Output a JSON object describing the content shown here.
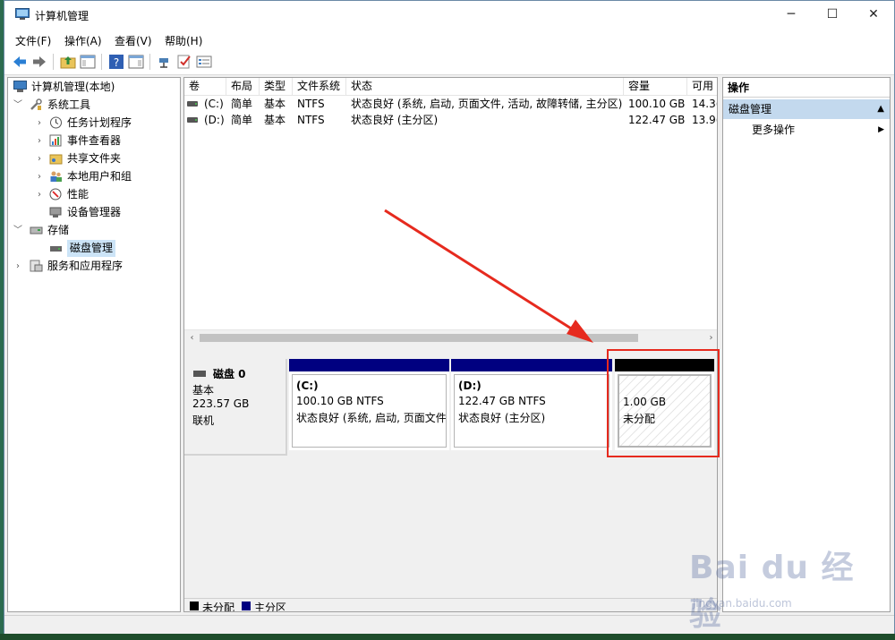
{
  "window": {
    "title": "计算机管理",
    "min": "─",
    "max": "☐",
    "close": "✕"
  },
  "menu": [
    "文件(F)",
    "操作(A)",
    "查看(V)",
    "帮助(H)"
  ],
  "tree": {
    "root": "计算机管理(本地)",
    "system_tools": "系统工具",
    "task_scheduler": "任务计划程序",
    "event_viewer": "事件查看器",
    "shared_folders": "共享文件夹",
    "local_users": "本地用户和组",
    "performance": "性能",
    "device_manager": "设备管理器",
    "storage": "存储",
    "disk_management": "磁盘管理",
    "services": "服务和应用程序"
  },
  "volume_list": {
    "headers": [
      "卷",
      "布局",
      "类型",
      "文件系统",
      "状态",
      "容量",
      "可用"
    ],
    "rows": [
      [
        "(C:)",
        "简单",
        "基本",
        "NTFS",
        "状态良好 (系统, 启动, 页面文件, 活动, 故障转储, 主分区)",
        "100.10 GB",
        "14.3("
      ],
      [
        "(D:)",
        "简单",
        "基本",
        "NTFS",
        "状态良好 (主分区)",
        "122.47 GB",
        "13.9("
      ]
    ]
  },
  "disk": {
    "name": "磁盘 0",
    "type": "基本",
    "size": "223.57 GB",
    "status": "联机",
    "partitions": [
      {
        "name": "(C:)",
        "size": "100.10 GB NTFS",
        "status": "状态良好 (系统, 启动, 页面文件"
      },
      {
        "name": "(D:)",
        "size": "122.47 GB NTFS",
        "status": "状态良好 (主分区)"
      },
      {
        "size": "1.00 GB",
        "status": "未分配"
      }
    ]
  },
  "legend": {
    "unallocated": "未分配",
    "primary": "主分区"
  },
  "actions": {
    "title": "操作",
    "section": "磁盘管理",
    "more": "更多操作"
  },
  "colors": {
    "primary": "#000080",
    "unallocated": "#000000",
    "annotation": "#e62a1e"
  },
  "watermark": {
    "brand": "Bai du 经验",
    "url": "jingyan.baidu.com"
  }
}
